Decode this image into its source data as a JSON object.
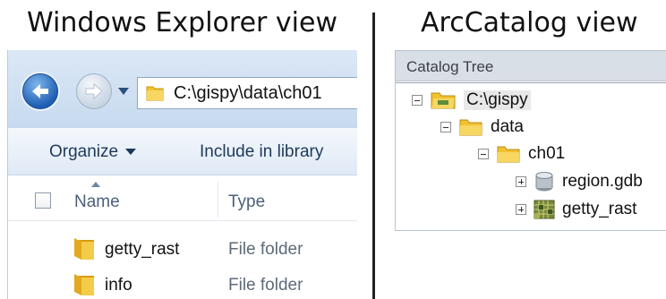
{
  "headings": {
    "left": "Windows Explorer view",
    "right": "ArcCatalog view"
  },
  "explorer": {
    "address": "C:\\gispy\\data\\ch01",
    "toolbar": {
      "organize": "Organize",
      "include_in_library": "Include in library"
    },
    "columns": {
      "name": "Name",
      "type": "Type"
    },
    "rows": [
      {
        "name": "getty_rast",
        "type": "File folder"
      },
      {
        "name": "info",
        "type": "File folder"
      }
    ]
  },
  "catalog": {
    "title": "Catalog Tree",
    "nodes": [
      {
        "label": "C:\\gispy",
        "icon": "connected-folder-icon"
      },
      {
        "label": "data",
        "icon": "folder-icon"
      },
      {
        "label": "ch01",
        "icon": "folder-icon"
      },
      {
        "label": "region.gdb",
        "icon": "geodatabase-icon"
      },
      {
        "label": "getty_rast",
        "icon": "raster-icon"
      }
    ]
  },
  "colors": {
    "folder": "#f2c230",
    "accent_blue": "#1f5fb3",
    "toolbar_text": "#1e395b"
  }
}
